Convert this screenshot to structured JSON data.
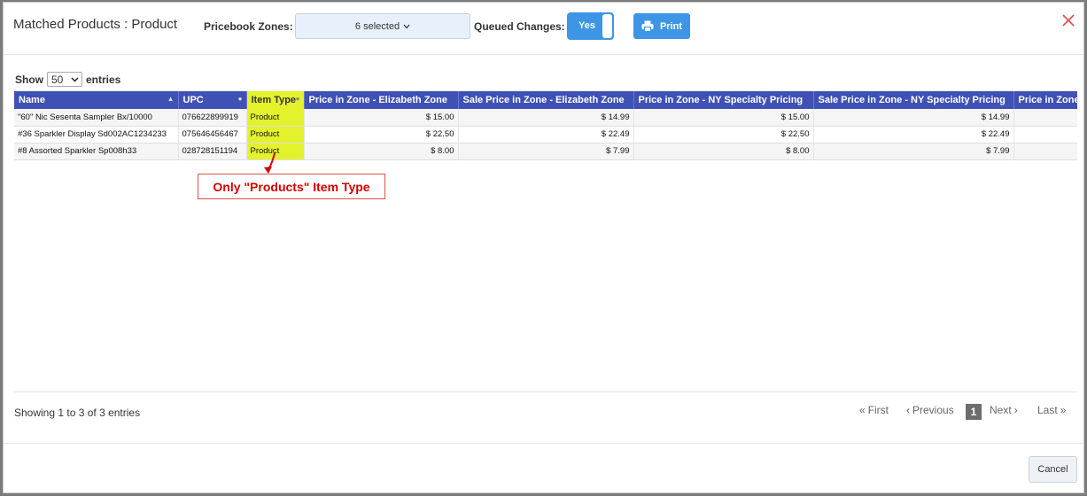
{
  "header": {
    "title": "Matched Products : Product",
    "zones_label": "Pricebook Zones:",
    "zones_value": "6 selected",
    "queued_label": "Queued Changes:",
    "queued_value": "Yes",
    "print_label": "Print"
  },
  "length": {
    "show_label": "Show",
    "value": "50",
    "entries_label": "entries"
  },
  "table": {
    "columns": [
      "Name",
      "UPC",
      "Item Type",
      "Price in Zone - Elizabeth Zone",
      "Sale Price in Zone - Elizabeth Zone",
      "Price in Zone - NY Specialty Pricing",
      "Sale Price in Zone - NY Specialty Pricing",
      "Price in Zone"
    ],
    "rows": [
      [
        "\"60\" Nic Sesenta Sampler Bx/10000",
        "076622899919",
        "Product",
        "$ 15.00",
        "$ 14.99",
        "$ 15.00",
        "$ 14.99"
      ],
      [
        "#36 Sparkler Display Sd002AC1234233",
        "075646456467",
        "Product",
        "$ 22.50",
        "$ 22.49",
        "$ 22.50",
        "$ 22.49"
      ],
      [
        "#8 Assorted Sparkler Sp008h33",
        "028728151194",
        "Product",
        "$ 8.00",
        "$ 7.99",
        "$ 8.00",
        "$ 7.99"
      ]
    ]
  },
  "annotation": "Only \"Products\" Item Type",
  "footer": {
    "info": "Showing 1 to 3 of 3 entries",
    "first": "First",
    "previous": "Previous",
    "current_page": "1",
    "next": "Next",
    "last": "Last",
    "cancel": "Cancel"
  },
  "colors": {
    "header_bg": "#3f51b5",
    "accent": "#3d95e6",
    "highlight": "#e4f22c",
    "annotation": "#d40000"
  },
  "icons": {
    "close": "close-icon",
    "print": "printer-icon",
    "dropdown": "chevron-down-icon",
    "sort": "sort-icon"
  }
}
